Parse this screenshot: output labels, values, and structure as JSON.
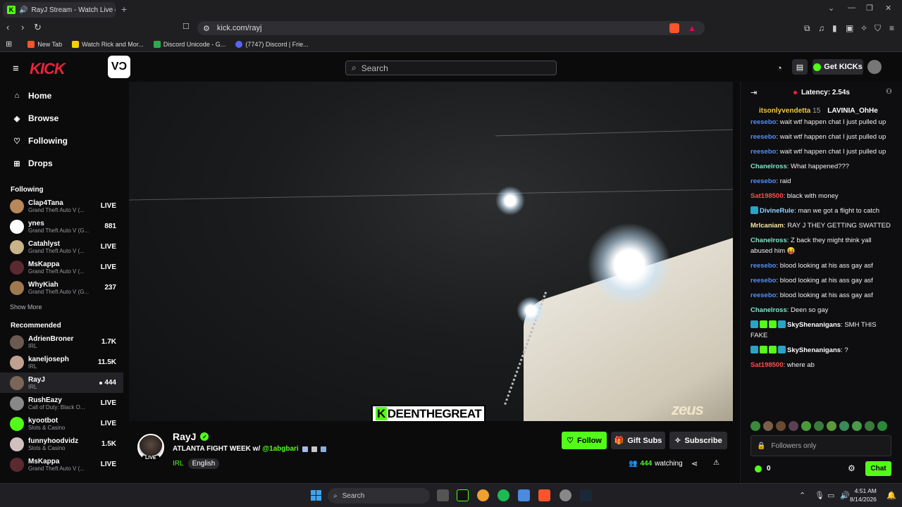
{
  "browser": {
    "tab_title": "RayJ Stream - Watch Live on",
    "url": "kick.com/rayj",
    "bookmarks": [
      "New Tab",
      "Watch Rick and Mor...",
      "Discord Unicode - G...",
      "(7747) Discord | Frie..."
    ]
  },
  "header": {
    "search_placeholder": "Search",
    "get_kicks": "Get KICKs"
  },
  "sidebar": {
    "nav": [
      {
        "label": "Home",
        "icon": "home-icon"
      },
      {
        "label": "Browse",
        "icon": "compass-icon"
      },
      {
        "label": "Following",
        "icon": "heart-icon"
      },
      {
        "label": "Drops",
        "icon": "drops-icon"
      }
    ],
    "following_title": "Following",
    "following": [
      {
        "name": "Clap4Tana",
        "category": "Grand Theft Auto V (...",
        "viewers": "LIVE",
        "color": "#b8875a"
      },
      {
        "name": "ynes",
        "category": "Grand Theft Auto V (G...",
        "viewers": "881",
        "color": "#ffffff"
      },
      {
        "name": "Catahlyst",
        "category": "Grand Theft Auto V (...",
        "viewers": "LIVE",
        "color": "#c9b48a"
      },
      {
        "name": "MsKappa",
        "category": "Grand Theft Auto V (...",
        "viewers": "LIVE",
        "color": "#5a2a30"
      },
      {
        "name": "WhyKiah",
        "category": "Grand Theft Auto V (G...",
        "viewers": "237",
        "color": "#a07850"
      }
    ],
    "show_more": "Show More",
    "recommended_title": "Recommended",
    "recommended": [
      {
        "name": "AdrienBroner",
        "category": "IRL",
        "viewers": "1.7K",
        "color": "#6a5a50",
        "active": false
      },
      {
        "name": "kaneljoseph",
        "category": "IRL",
        "viewers": "11.5K",
        "color": "#c0a090",
        "active": false
      },
      {
        "name": "RayJ",
        "category": "IRL",
        "viewers": "444",
        "color": "#7a6558",
        "active": true
      },
      {
        "name": "RushEazy",
        "category": "Call of Duty: Black O...",
        "viewers": "LIVE",
        "color": "#888888",
        "active": false
      },
      {
        "name": "kyootbot",
        "category": "Slots & Casino",
        "viewers": "LIVE",
        "color": "#53fc18",
        "active": false
      },
      {
        "name": "funnyhoodvidz",
        "category": "Slots & Casino",
        "viewers": "1.5K",
        "color": "#d0c0c0",
        "active": false
      },
      {
        "name": "MsKappa",
        "category": "Grand Theft Auto V (...",
        "viewers": "LIVE",
        "color": "#5a2a30",
        "active": false
      }
    ]
  },
  "video": {
    "overlay_k": "K",
    "overlay_name": "DEENTHEGREAT",
    "watermark": "zeus"
  },
  "stream": {
    "live_badge": "LIVE",
    "streamer": "RayJ",
    "title": "ATLANTA FIGHT WEEK w/",
    "mention": "@1abgbari",
    "category": "IRL",
    "language": "English",
    "follow": "Follow",
    "gift_subs": "Gift Subs",
    "subscribe": "Subscribe",
    "viewers": "444",
    "watching": "watching"
  },
  "chat": {
    "latency": "Latency: 2.54s",
    "pinned": [
      {
        "name": "itsonlyvendetta",
        "count": "15"
      },
      {
        "name": "LAVINIA_OhHe",
        "count": ""
      }
    ],
    "messages": [
      {
        "user": "reesebo",
        "color": "#4f8fff",
        "text": "wait wtf happen chat I just pulled up"
      },
      {
        "user": "reesebo",
        "color": "#4f8fff",
        "text": "wait wtf happen chat I just pulled up"
      },
      {
        "user": "reesebo",
        "color": "#4f8fff",
        "text": "wait wtf happen chat I just pulled up"
      },
      {
        "user": "Chanelross",
        "color": "#7fe8c8",
        "text": "What happened???"
      },
      {
        "user": "reesebo",
        "color": "#4f8fff",
        "text": "raid"
      },
      {
        "user": "Sat198500",
        "color": "#ff4d4d",
        "text": "black with money"
      },
      {
        "user": "DivineRule",
        "color": "#8fd3ff",
        "text": "man we got a flight to catch",
        "badge": "#2aa3c8"
      },
      {
        "user": "Mrlcaniam",
        "color": "#f5e9a0",
        "text": "RAY J THEY GETTING SWATTED"
      },
      {
        "user": "Chanelross",
        "color": "#7fe8c8",
        "text": "Z back they might think yall abused him 😝"
      },
      {
        "user": "reesebo",
        "color": "#4f8fff",
        "text": "blood looking at his ass gay asf"
      },
      {
        "user": "reesebo",
        "color": "#4f8fff",
        "text": "blood looking at his ass gay asf"
      },
      {
        "user": "reesebo",
        "color": "#4f8fff",
        "text": "blood looking at his ass gay asf"
      },
      {
        "user": "Chanelross",
        "color": "#7fe8c8",
        "text": "Deen so gay"
      },
      {
        "user": "SkyShenanigans",
        "color": "#ffffff",
        "text": "SMH THIS FAKE",
        "badges": [
          "#2aa3c8",
          "#53fc18",
          "#53fc18",
          "#2aa3c8"
        ]
      },
      {
        "user": "SkyShenanigans",
        "color": "#ffffff",
        "text": "?",
        "badges": [
          "#2aa3c8",
          "#53fc18",
          "#53fc18",
          "#2aa3c8"
        ]
      },
      {
        "user": "Sat198500",
        "color": "#ff4d4d",
        "text": "where ab"
      }
    ],
    "input_placeholder": "Followers only",
    "kicks_count": "0",
    "send": "Chat"
  },
  "taskbar": {
    "search": "Search",
    "time": "4:51 AM",
    "date": "8/14/2026"
  }
}
